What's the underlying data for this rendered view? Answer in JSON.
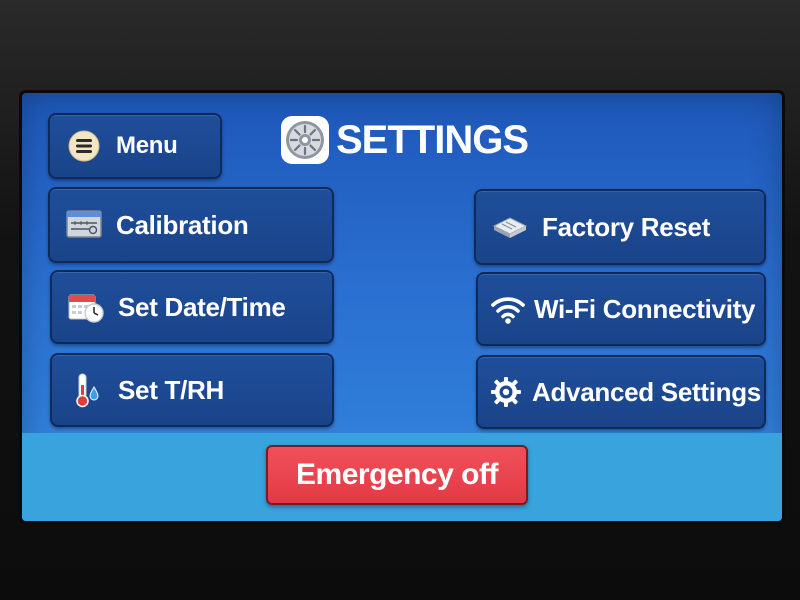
{
  "title": "SETTINGS",
  "menu": {
    "label": "Menu",
    "icon": "menu-icon"
  },
  "left_buttons": [
    {
      "label": "Calibration",
      "icon": "calibration-icon"
    },
    {
      "label": "Set Date/Time",
      "icon": "calendar-clock-icon"
    },
    {
      "label": "Set T/RH",
      "icon": "thermometer-droplet-icon"
    }
  ],
  "right_buttons": [
    {
      "label": "Factory Reset",
      "icon": "reset-chip-icon"
    },
    {
      "label": "Wi-Fi Connectivity",
      "icon": "wifi-icon"
    },
    {
      "label": "Advanced Settings",
      "icon": "advanced-gear-icon"
    }
  ],
  "emergency": {
    "label": "Emergency off"
  },
  "colors": {
    "screen": "#2a6fd1",
    "button": "#1f4e9a",
    "button_border": "#0d2a5c",
    "bottom_band": "#38a3dc",
    "emergency": "#e8434d",
    "text": "#ffffff"
  }
}
